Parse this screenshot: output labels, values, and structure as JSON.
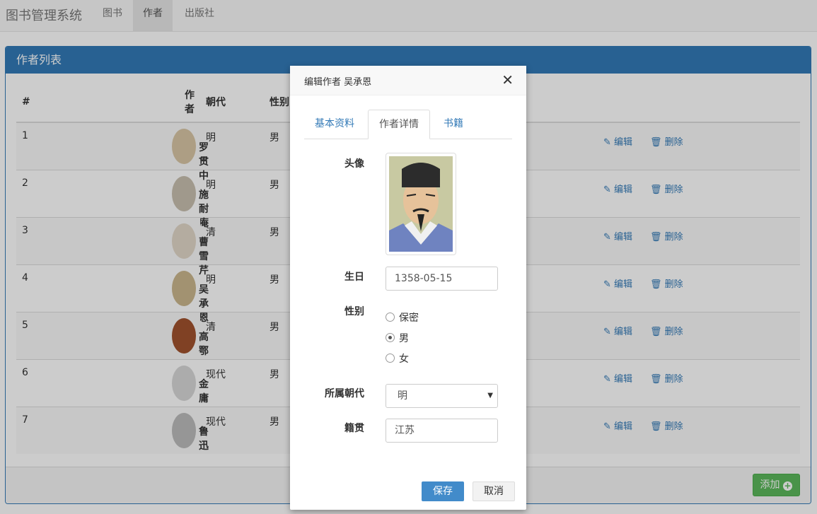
{
  "navbar": {
    "brand": "图书管理系统",
    "items": [
      {
        "label": "图书",
        "active": false
      },
      {
        "label": "作者",
        "active": true
      },
      {
        "label": "出版社",
        "active": false
      }
    ]
  },
  "panel": {
    "title": "作者列表",
    "columns": [
      "#",
      "作者",
      "朝代",
      "性别"
    ],
    "rows": [
      {
        "id": "1",
        "name": "罗贯中",
        "dynasty": "明",
        "gender": "男"
      },
      {
        "id": "2",
        "name": "施耐庵",
        "dynasty": "明",
        "gender": "男"
      },
      {
        "id": "3",
        "name": "曹雪芹",
        "dynasty": "清",
        "gender": "男"
      },
      {
        "id": "4",
        "name": "吴承恩",
        "dynasty": "明",
        "gender": "男"
      },
      {
        "id": "5",
        "name": "高鄂",
        "dynasty": "清",
        "gender": "男"
      },
      {
        "id": "6",
        "name": "金庸",
        "dynasty": "现代",
        "gender": "男"
      },
      {
        "id": "7",
        "name": "鲁迅",
        "dynasty": "现代",
        "gender": "男"
      }
    ],
    "edit_label": "编辑",
    "delete_label": "删除",
    "add_label": "添加"
  },
  "modal": {
    "title": "编辑作者 吴承恩",
    "tabs": [
      {
        "label": "基本资料",
        "active": false
      },
      {
        "label": "作者详情",
        "active": true
      },
      {
        "label": "书籍",
        "active": false
      }
    ],
    "avatar_label": "头像",
    "birthday_label": "生日",
    "birthday_value": "1358-05-15",
    "gender_label": "性别",
    "gender_options": [
      "保密",
      "男",
      "女"
    ],
    "gender_selected": "男",
    "dynasty_label": "所属朝代",
    "dynasty_value": "明",
    "hometown_label": "籍贯",
    "hometown_value": "江苏",
    "save_label": "保存",
    "cancel_label": "取消"
  },
  "colors": {
    "primary": "#337ab7",
    "success": "#5cb85c",
    "save": "#428bca"
  },
  "icons": {
    "edit": "edit-icon",
    "delete": "trash-icon",
    "add": "plus-circle-icon",
    "close": "close-icon"
  }
}
